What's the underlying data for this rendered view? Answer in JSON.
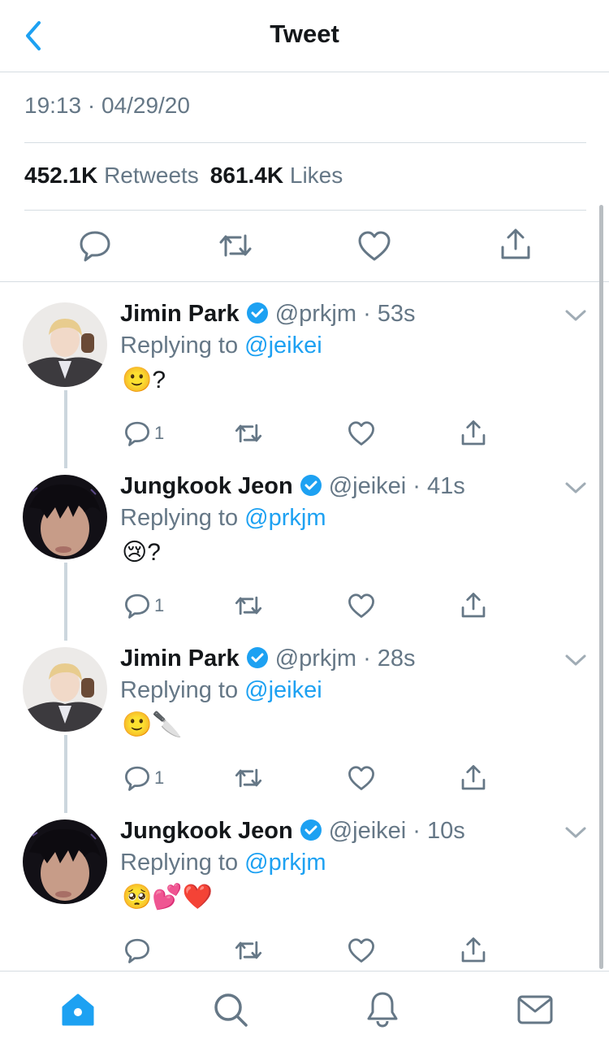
{
  "header": {
    "title": "Tweet",
    "back_icon": "chevron-left-icon"
  },
  "tweet_meta": {
    "timestamp": "19:13 · 04/29/20"
  },
  "stats": {
    "retweets_count": "452.1K",
    "retweets_label": "Retweets",
    "likes_count": "861.4K",
    "likes_label": "Likes"
  },
  "main_actions": [
    "reply-icon",
    "retweet-icon",
    "like-icon",
    "share-icon"
  ],
  "replies": [
    {
      "name": "Jimin Park",
      "handle": "@prkjm",
      "time": "· 53s",
      "replying_prefix": "Replying to",
      "replying_to": "@jeikei",
      "text": "🙂?",
      "reply_count": "1",
      "avatar": "jimin-avatar"
    },
    {
      "name": "Jungkook Jeon",
      "handle": "@jeikei",
      "time": "· 41s",
      "replying_prefix": "Replying to",
      "replying_to": "@prkjm",
      "text": "😢?",
      "reply_count": "1",
      "avatar": "jungkook-avatar"
    },
    {
      "name": "Jimin Park",
      "handle": "@prkjm",
      "time": "· 28s",
      "replying_prefix": "Replying to",
      "replying_to": "@jeikei",
      "text": "🙂🔪",
      "reply_count": "1",
      "avatar": "jimin-avatar"
    },
    {
      "name": "Jungkook Jeon",
      "handle": "@jeikei",
      "time": "· 10s",
      "replying_prefix": "Replying to",
      "replying_to": "@prkjm",
      "text": "🥺💕❤️",
      "reply_count": "",
      "avatar": "jungkook-avatar"
    }
  ],
  "tab_bar": {
    "items": [
      "home-icon",
      "search-icon",
      "notifications-icon",
      "messages-icon"
    ],
    "active": "home-icon"
  },
  "colors": {
    "accent": "#1da1f2",
    "secondary_text": "#657786",
    "divider": "#d6dde2",
    "verified": "#1da1f2"
  }
}
